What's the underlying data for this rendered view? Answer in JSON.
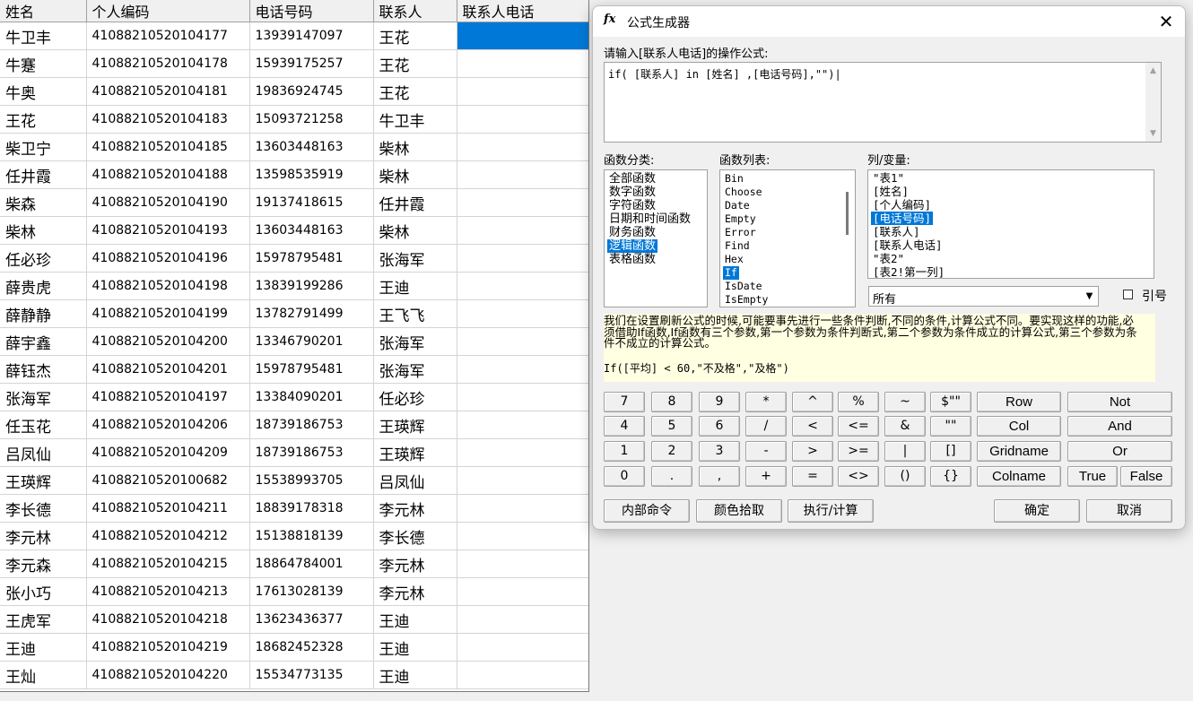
{
  "sheet": {
    "headers": [
      "姓名",
      "个人编码",
      "电话号码",
      "联系人",
      "联系人电话"
    ],
    "rows": [
      [
        "牛卫丰",
        "41088210520104177",
        "13939147097",
        "王花",
        ""
      ],
      [
        "牛蹇",
        "41088210520104178",
        "15939175257",
        "王花",
        ""
      ],
      [
        "牛奥",
        "41088210520104181",
        "19836924745",
        "王花",
        ""
      ],
      [
        "王花",
        "41088210520104183",
        "15093721258",
        "牛卫丰",
        ""
      ],
      [
        "柴卫宁",
        "41088210520104185",
        "13603448163",
        "柴林",
        ""
      ],
      [
        "任井霞",
        "41088210520104188",
        "13598535919",
        "柴林",
        ""
      ],
      [
        "柴森",
        "41088210520104190",
        "19137418615",
        "任井霞",
        ""
      ],
      [
        "柴林",
        "41088210520104193",
        "13603448163",
        "柴林",
        ""
      ],
      [
        "任必珍",
        "41088210520104196",
        "15978795481",
        "张海军",
        ""
      ],
      [
        "薛贵虎",
        "41088210520104198",
        "13839199286",
        "王迪",
        ""
      ],
      [
        "薛静静",
        "41088210520104199",
        "13782791499",
        "王飞飞",
        ""
      ],
      [
        "薛宇鑫",
        "41088210520104200",
        "13346790201",
        "张海军",
        ""
      ],
      [
        "薛钰杰",
        "41088210520104201",
        "15978795481",
        "张海军",
        ""
      ],
      [
        "张海军",
        "41088210520104197",
        "13384090201",
        "任必珍",
        ""
      ],
      [
        "任玉花",
        "41088210520104206",
        "18739186753",
        "王瑛辉",
        ""
      ],
      [
        "吕凤仙",
        "41088210520104209",
        "18739186753",
        "王瑛辉",
        ""
      ],
      [
        "王瑛辉",
        "41088210520100682",
        "15538993705",
        "吕凤仙",
        ""
      ],
      [
        "李长德",
        "41088210520104211",
        "18839178318",
        "李元林",
        ""
      ],
      [
        "李元林",
        "41088210520104212",
        "15138818139",
        "李长德",
        ""
      ],
      [
        "李元森",
        "41088210520104215",
        "18864784001",
        "李元林",
        ""
      ],
      [
        "张小巧",
        "41088210520104213",
        "17613028139",
        "李元林",
        ""
      ],
      [
        "王虎军",
        "41088210520104218",
        "13623436377",
        "王迪",
        ""
      ],
      [
        "王迪",
        "41088210520104219",
        "18682452328",
        "王迪",
        ""
      ],
      [
        "王灿",
        "41088210520104220",
        "15534773135",
        "王迪",
        ""
      ]
    ]
  },
  "dialog": {
    "icon": "fx",
    "title": "公式生成器",
    "close": "✕",
    "formula_label": "请输入[联系人电话]的操作公式:",
    "formula": "if( [联系人] in [姓名] ,[电话号码],\"\")|",
    "category_label": "函数分类:",
    "categories": [
      "全部函数",
      "数字函数",
      "字符函数",
      "日期和时间函数",
      "财务函数",
      "逻辑函数",
      "表格函数"
    ],
    "function_label": "函数列表:",
    "functions": [
      "Bin",
      "Choose",
      "Date",
      "Empty",
      "Error",
      "Find",
      "Hex",
      "If",
      "IsDate",
      "IsEmpty"
    ],
    "variable_label": "列/变量:",
    "variables": [
      "\"表1\"",
      "[姓名]",
      "[个人编码]",
      "[电话号码]",
      "[联系人]",
      "[联系人电话]",
      "\"表2\"",
      "[表2!第一列]"
    ],
    "combo_value": "所有",
    "quote_label": "引号",
    "description": "我们在设置刷新公式的时候,可能要事先进行一些条件判断,不同的条件,计算公式不同。要实现这样的功能,必须借助If函数,If函数有三个参数,第一个参数为条件判断式,第二个参数为条件成立的计算公式,第三个参数为条件不成立的计算公式。",
    "description_example": "If([平均] < 60,\"不及格\",\"及格\")",
    "keypad": [
      [
        "7",
        "8",
        "9",
        "*",
        "^",
        "%",
        "~",
        "$\"\""
      ],
      [
        "4",
        "5",
        "6",
        "/",
        "<",
        "<=",
        "&",
        "\"\""
      ],
      [
        "1",
        "2",
        "3",
        "-",
        ">",
        ">=",
        "|",
        "[]"
      ],
      [
        "0",
        ".",
        ",",
        "+",
        "=",
        "<>",
        "()",
        "{}"
      ]
    ],
    "word_buttons": {
      "row": "Row",
      "col": "Col",
      "gridname": "Gridname",
      "colname": "Colname",
      "not": "Not",
      "and": "And",
      "or": "Or",
      "true": "True",
      "false": "False"
    },
    "bottom_buttons": {
      "internal_command": "内部命令",
      "color_picker": "颜色拾取",
      "execute": "执行/计算",
      "ok": "确定",
      "cancel": "取消"
    }
  }
}
